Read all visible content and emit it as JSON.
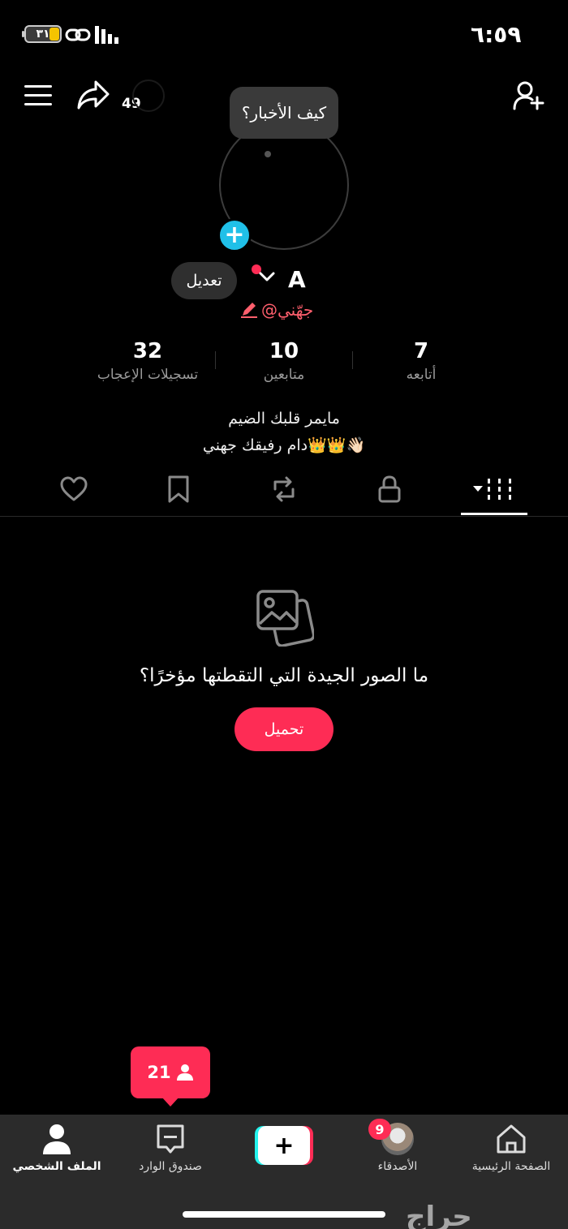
{
  "status_bar": {
    "time": "٦:٥٩",
    "battery": "٣١"
  },
  "header": {
    "share_count": "49"
  },
  "profile": {
    "bubble_text": "كيف الأخبار؟",
    "name": "A",
    "username": "@جهّني",
    "edit_label": "تعديل",
    "stats": [
      {
        "value": "32",
        "label": "تسجيلات الإعجاب"
      },
      {
        "value": "10",
        "label": "متابعين"
      },
      {
        "value": "7",
        "label": "أتابعه"
      }
    ],
    "bio_line1": "مايمر قلبك الضيم",
    "bio_line2": "دام رفيقك جهني👑👑👋🏻"
  },
  "tabs": [
    "liked-icon",
    "saved-icon",
    "repost-icon",
    "private-icon",
    "videos-grid-icon"
  ],
  "empty_state": {
    "message": "ما الصور الجيدة التي التقطتها مؤخرًا؟",
    "button_label": "تحميل"
  },
  "notification_popup": {
    "count": "21"
  },
  "bottom_nav": {
    "profile": "الملف الشخصي",
    "inbox": "صندوق الوارد",
    "friends": "الأصدقاء",
    "friends_badge": "9",
    "home": "الصفحة الرئيسية"
  },
  "watermark": "حراج",
  "colors": {
    "accent": "#fe2c55",
    "cyan": "#25f4ee",
    "add_blue": "#20c0e8"
  }
}
